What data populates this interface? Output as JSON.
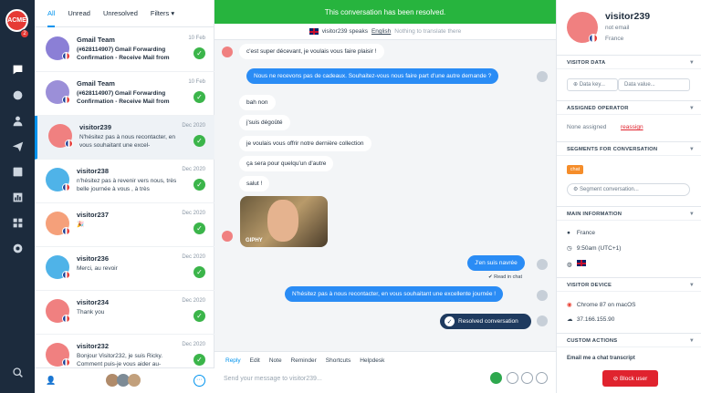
{
  "app": {
    "logo_text": "ACME",
    "notification_count": "2"
  },
  "inbox": {
    "filters": [
      "All",
      "Unread",
      "Unresolved",
      "Filters ▾"
    ],
    "conversations": [
      {
        "name": "Gmail Team",
        "date": "10 Feb",
        "preview": "(#628114907) Gmail Forwarding Confirmation - Receive Mail from",
        "avatar_color": "#8b7fd6"
      },
      {
        "name": "Gmail Team",
        "date": "10 Feb",
        "preview": "(#628114907) Gmail Forwarding Confirmation - Receive Mail from",
        "avatar_color": "#9b8fd8"
      },
      {
        "name": "visitor239",
        "date": "Dec 2020",
        "preview": "N'hésitez pas à nous recontacter, en vous souhaitant une excel-",
        "avatar_color": "#f08080"
      },
      {
        "name": "visitor238",
        "date": "Dec 2020",
        "preview": "n'hésitez pas à revenir vers nous, très belle journée à vous , à très",
        "avatar_color": "#4fb3e8"
      },
      {
        "name": "visitor237",
        "date": "Dec 2020",
        "preview": "🎉",
        "avatar_color": "#f5a07a"
      },
      {
        "name": "visitor236",
        "date": "Dec 2020",
        "preview": "Merci, au revoir",
        "avatar_color": "#4fb3e8"
      },
      {
        "name": "visitor234",
        "date": "Dec 2020",
        "preview": "Thank you",
        "avatar_color": "#f08080"
      },
      {
        "name": "visitor232",
        "date": "Dec 2020",
        "preview": "Bonjour Visitor232, je suis Ricky. Comment puis-je vous aider au-",
        "avatar_color": "#f08080"
      }
    ]
  },
  "chat": {
    "banner": "This conversation has been resolved.",
    "speaks_prefix": "visitor239 speaks",
    "speaks_language": "English",
    "speaks_note": "Nothing to translate there",
    "messages": [
      {
        "dir": "in",
        "text": "c'est super décevant, je voulais vous faire plaisir !"
      },
      {
        "dir": "out",
        "text": "Nous ne recevons pas de cadeaux. Souhaitez-vous nous faire part d'une autre demande ?"
      },
      {
        "dir": "in",
        "text": "bah non"
      },
      {
        "dir": "in",
        "text": "j'suis dégoûté"
      },
      {
        "dir": "in",
        "text": "je voulais vous offrir notre dernière collection"
      },
      {
        "dir": "in",
        "text": "ça sera pour quelqu'un d'autre"
      },
      {
        "dir": "in",
        "text": "salut !"
      },
      {
        "dir": "out",
        "text": "J'en suis navrée"
      },
      {
        "dir": "out",
        "text": "N'hésitez pas à nous recontacter, en vous souhaitant une excellente journée !"
      }
    ],
    "gif_label": "GIPHY",
    "read_receipt": "✔ Read in chat",
    "resolved_button": "Resolved conversation",
    "composer_tabs": [
      "Reply",
      "Edit",
      "Note",
      "Reminder",
      "Shortcuts",
      "Helpdesk"
    ],
    "composer_placeholder": "Send your message to visitor239..."
  },
  "visitor": {
    "name": "visitor239",
    "email": "not email",
    "country": "France",
    "sections": {
      "visitor_data": "VISITOR DATA",
      "assigned_operator": "ASSIGNED OPERATOR",
      "segments": "SEGMENTS FOR CONVERSATION",
      "main_info": "MAIN INFORMATION",
      "visitor_device": "VISITOR DEVICE",
      "custom_actions": "CUSTOM ACTIONS"
    },
    "data_key_placeholder": "Data key...",
    "data_value_placeholder": "Data value...",
    "assigned_label": "None assigned",
    "assigned_action": "reassign",
    "segment_tag": "chat",
    "segment_placeholder": "Segment conversation...",
    "location": "France",
    "local_time": "9:50am (UTC+1)",
    "browser": "Chrome 87 on macOS",
    "ip": "37.166.155.90",
    "custom_action": "Email me a chat transcript",
    "block_label": "Block user"
  }
}
